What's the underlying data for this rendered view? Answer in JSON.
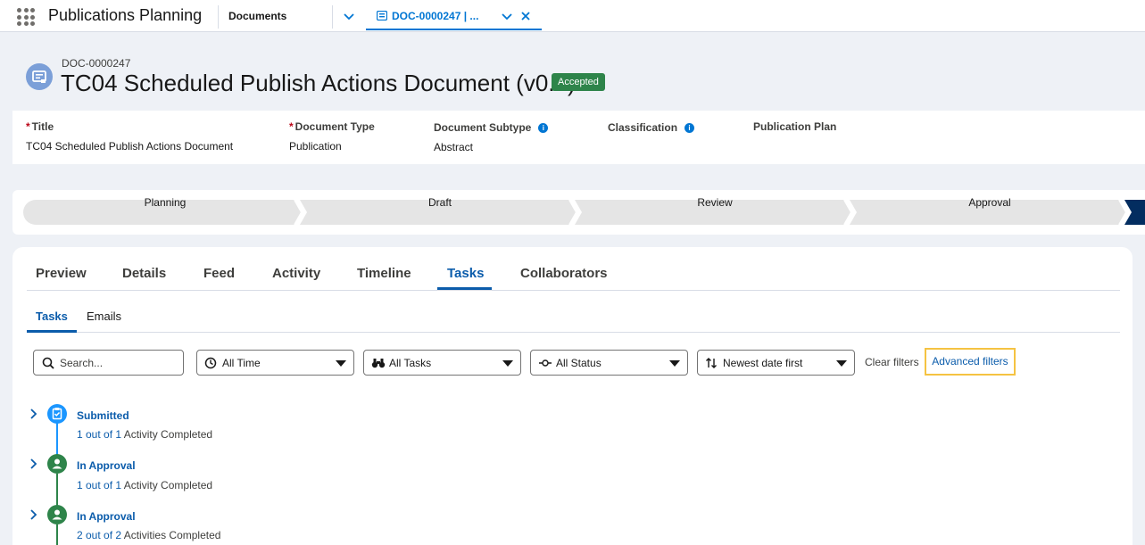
{
  "app": {
    "name": "Publications Planning"
  },
  "tabs": {
    "documents_label": "Documents",
    "active_label": "DOC-0000247 | ..."
  },
  "record": {
    "number": "DOC-0000247",
    "title": "TC04 Scheduled Publish Actions Document (v0.1)",
    "status_badge": "Accepted"
  },
  "fields": {
    "title_label": "Title",
    "title_value": "TC04 Scheduled Publish Actions Document",
    "doctype_label": "Document Type",
    "doctype_value": "Publication",
    "subtype_label": "Document Subtype",
    "subtype_value": "Abstract",
    "classification_label": "Classification",
    "plan_label": "Publication Plan",
    "required_mark": "*",
    "info_glyph": "i"
  },
  "path": {
    "steps": [
      "Planning",
      "Draft",
      "Review",
      "Approval"
    ]
  },
  "main_tabs": [
    "Preview",
    "Details",
    "Feed",
    "Activity",
    "Timeline",
    "Tasks",
    "Collaborators"
  ],
  "main_tabs_active": "Tasks",
  "sub_tabs": [
    "Tasks",
    "Emails"
  ],
  "sub_tabs_active": "Tasks",
  "filters": {
    "search_placeholder": "Search...",
    "time": "All Time",
    "tasks": "All Tasks",
    "status": "All Status",
    "sort": "Newest date first",
    "clear_label": "Clear filters",
    "advanced_label": "Advanced filters"
  },
  "timeline": [
    {
      "title": "Submitted",
      "link": "1 out of 1",
      "text": "Activity Completed",
      "icon": "clipboard-icon",
      "color": "#1b96ff"
    },
    {
      "title": "In Approval",
      "link": "1 out of 1",
      "text": "Activity Completed",
      "icon": "user-icon",
      "color": "#2e844a"
    },
    {
      "title": "In Approval",
      "link": "2 out of 2",
      "text": "Activities Completed",
      "icon": "user-icon",
      "color": "#2e844a"
    }
  ],
  "colors": {
    "brand": "#0b5cab",
    "badge": "#2e844a",
    "highlight": "#f5c342"
  }
}
